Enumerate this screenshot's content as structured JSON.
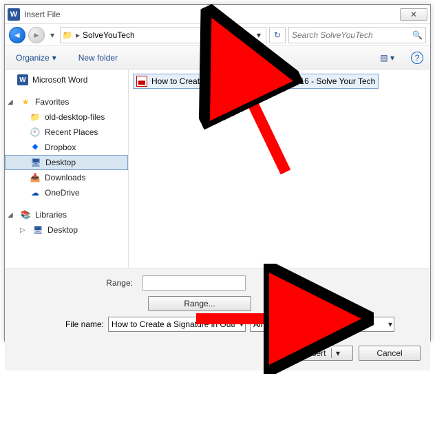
{
  "titlebar": {
    "title": "Insert File"
  },
  "breadcrumb": {
    "folder": "SolveYouTech"
  },
  "search": {
    "placeholder": "Search SolveYouTech"
  },
  "toolbar": {
    "organize": "Organize",
    "newfolder": "New folder"
  },
  "tree": {
    "word": "Microsoft Word",
    "favorites": "Favorites",
    "fav_items": [
      "old-desktop-files",
      "Recent Places",
      "Dropbox",
      "Desktop",
      "Downloads",
      "OneDrive"
    ],
    "libraries": "Libraries",
    "lib_items": [
      "Desktop"
    ]
  },
  "filelist": {
    "items": [
      {
        "name": "How to Create a Signature in Outlook 2016 - Solve Your Tech"
      }
    ]
  },
  "bottom": {
    "range_label": "Range:",
    "range_btn": "Range...",
    "filename_label": "File name:",
    "filename_value": "How to Create a Signature in Outl",
    "filter": "All Word Documents",
    "insert": "Insert",
    "cancel": "Cancel"
  }
}
